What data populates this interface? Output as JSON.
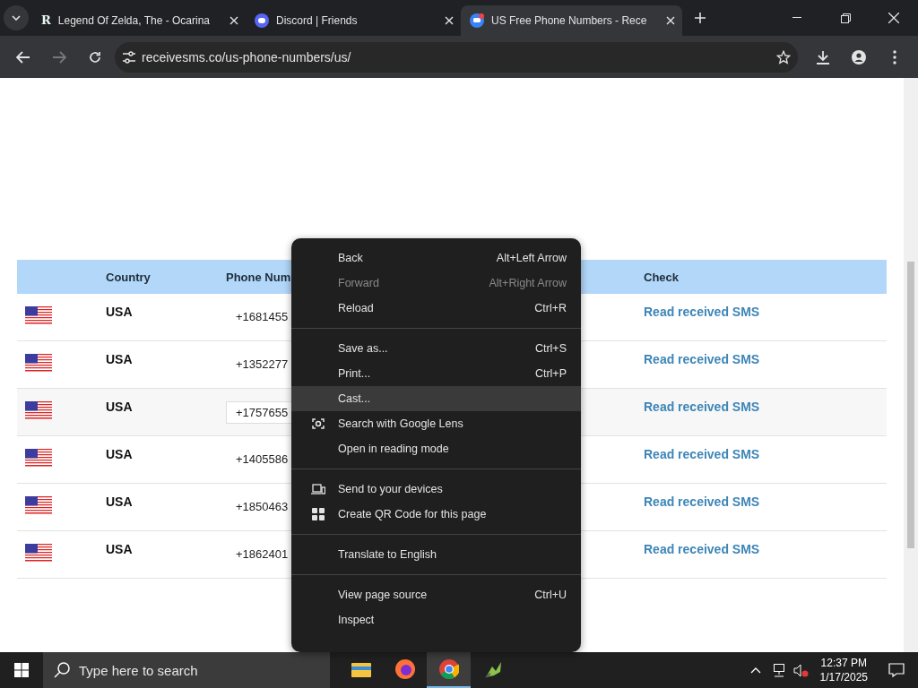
{
  "browser": {
    "tabs": [
      {
        "title": "Legend Of Zelda, The - Ocarina",
        "kind": "r",
        "favicon_text": "R",
        "selected": false
      },
      {
        "title": "Discord | Friends",
        "kind": "discord",
        "selected": false
      },
      {
        "title": "US Free Phone Numbers - Rece",
        "kind": "chat",
        "selected": true
      }
    ],
    "url": "receivesms.co/us-phone-numbers/us/"
  },
  "table": {
    "columns": [
      "Country",
      "Phone Num",
      "Check"
    ],
    "rows": [
      {
        "country": "USA",
        "phone": "+1681455",
        "check": "Read received SMS",
        "highlighted": false
      },
      {
        "country": "USA",
        "phone": "+1352277",
        "check": "Read received SMS",
        "highlighted": false
      },
      {
        "country": "USA",
        "phone": "+1757655",
        "check": "Read received SMS",
        "highlighted": true
      },
      {
        "country": "USA",
        "phone": "+1405586",
        "check": "Read received SMS",
        "highlighted": false
      },
      {
        "country": "USA",
        "phone": "+1850463",
        "check": "Read received SMS",
        "highlighted": false
      },
      {
        "country": "USA",
        "phone": "+1862401",
        "check": "Read received SMS",
        "highlighted": false
      }
    ]
  },
  "context_menu": {
    "groups": [
      [
        {
          "label": "Back",
          "shortcut": "Alt+Left Arrow",
          "disabled": false,
          "selected": false,
          "kind": "text"
        },
        {
          "label": "Forward",
          "shortcut": "Alt+Right Arrow",
          "disabled": true,
          "selected": false,
          "kind": "text"
        },
        {
          "label": "Reload",
          "shortcut": "Ctrl+R",
          "disabled": false,
          "selected": false,
          "kind": "text"
        }
      ],
      [
        {
          "label": "Save as...",
          "shortcut": "Ctrl+S",
          "disabled": false,
          "selected": false,
          "kind": "text"
        },
        {
          "label": "Print...",
          "shortcut": "Ctrl+P",
          "disabled": false,
          "selected": false,
          "kind": "text"
        },
        {
          "label": "Cast...",
          "disabled": false,
          "selected": true,
          "kind": "text"
        },
        {
          "label": "Search with Google Lens",
          "disabled": false,
          "selected": false,
          "kind": "lens"
        },
        {
          "label": "Open in reading mode",
          "disabled": false,
          "selected": false,
          "kind": "text"
        }
      ],
      [
        {
          "label": "Send to your devices",
          "disabled": false,
          "selected": false,
          "kind": "devices"
        },
        {
          "label": "Create QR Code for this page",
          "disabled": false,
          "selected": false,
          "kind": "qr"
        }
      ],
      [
        {
          "label": "Translate to English",
          "disabled": false,
          "selected": false,
          "kind": "text"
        }
      ],
      [
        {
          "label": "View page source",
          "shortcut": "Ctrl+U",
          "disabled": false,
          "selected": false,
          "kind": "text"
        },
        {
          "label": "Inspect",
          "disabled": false,
          "selected": false,
          "kind": "text"
        }
      ]
    ]
  },
  "taskbar": {
    "search_placeholder": "Type here to search",
    "apps": [
      {
        "kind": "folder",
        "selected": false
      },
      {
        "kind": "firefox",
        "selected": false
      },
      {
        "kind": "chrome",
        "selected": true
      },
      {
        "kind": "app",
        "selected": false
      }
    ],
    "time": "12:37 PM",
    "date": "1/17/2025"
  }
}
